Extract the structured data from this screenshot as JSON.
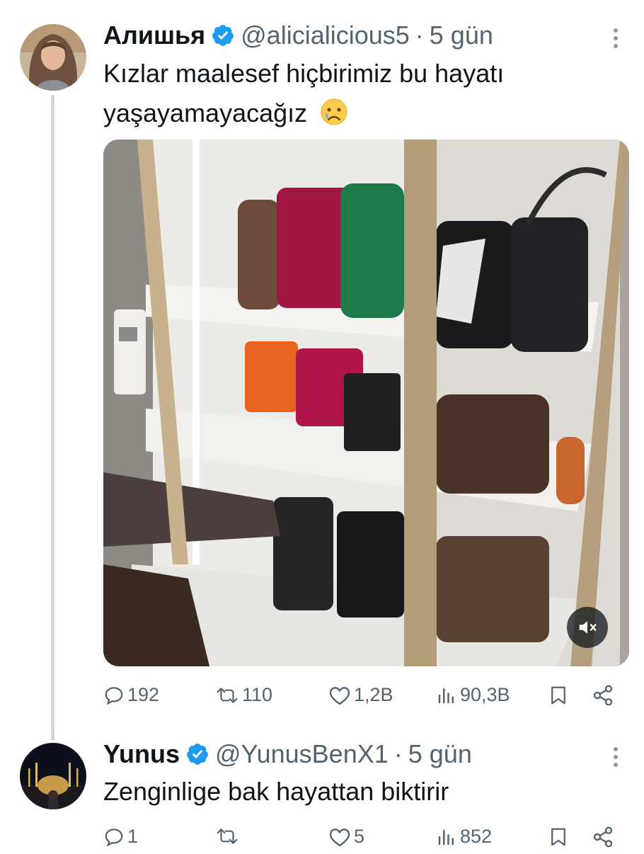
{
  "tweets": [
    {
      "author_name": "Алишья",
      "handle": "@alicialicious5",
      "separator": "·",
      "time": "5 gün",
      "text_line1": "Kızlar maalesef hiçbirimiz bu hayatı",
      "text_line2": "yaşayamayacağız",
      "emoji": "😢",
      "media": {
        "type": "video",
        "muted": true,
        "icon": "volume-mute-icon"
      },
      "stats": {
        "replies": "192",
        "retweets": "110",
        "likes": "1,2B",
        "views": "90,3B"
      }
    },
    {
      "author_name": "Yunus",
      "handle": "@YunusBenX1",
      "separator": "·",
      "time": "5 gün",
      "text_line1": "Zenginlige bak hayattan biktirir",
      "stats": {
        "replies": "1",
        "retweets": "",
        "likes": "5",
        "views": "852"
      }
    }
  ],
  "colors": {
    "verified": "#1d9bf0",
    "secondary_text": "#536471",
    "thread_line": "#cfd9de"
  }
}
